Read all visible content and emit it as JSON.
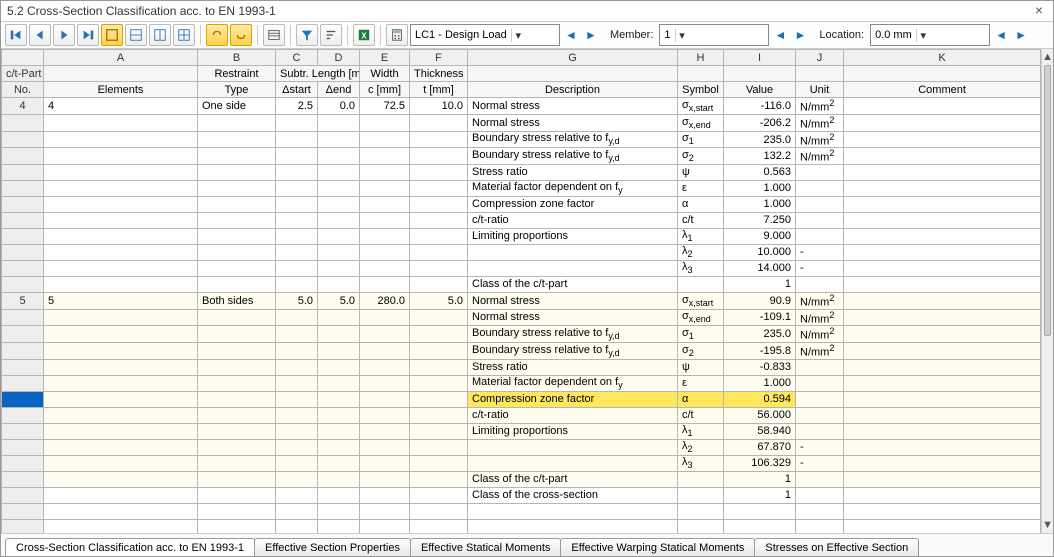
{
  "window": {
    "title": "5.2 Cross-Section Classification acc. to EN 1993-1"
  },
  "toolbar": {
    "combo_loadcase": "LC1 - Design Load",
    "label_member": "Member:",
    "combo_member": "1",
    "label_location": "Location:",
    "combo_location": "0.0 mm"
  },
  "columns": {
    "letters": [
      "A",
      "B",
      "C",
      "D",
      "E",
      "F",
      "G",
      "H",
      "I",
      "J",
      "K"
    ],
    "rowhead": [
      "c/t-Part",
      "No."
    ],
    "A": "Elements",
    "B": [
      "Restraint",
      "Type"
    ],
    "CD": "Subtr. Length [mm]",
    "C": "Δstart",
    "D": "Δend",
    "E": [
      "Width",
      "c [mm]"
    ],
    "F": [
      "Thickness",
      "t [mm]"
    ],
    "G": "Description",
    "H": "Symbol",
    "I": "Value",
    "J": "Unit",
    "K": "Comment"
  },
  "rows": [
    {
      "no": "4",
      "A": "4",
      "B": "One side",
      "C": "2.5",
      "D": "0.0",
      "E": "72.5",
      "F": "10.0",
      "G": "Normal stress",
      "H": "σ<sub>x,start</sub>",
      "I": "-116.0",
      "J": "N/mm<sup>2</sup>",
      "K": ""
    },
    {
      "G": "Normal stress",
      "H": "σ<sub>x,end</sub>",
      "I": "-206.2",
      "J": "N/mm<sup>2</sup>"
    },
    {
      "G": "Boundary stress relative to f<sub>y,d</sub>",
      "H": "σ<sub>1</sub>",
      "I": "235.0",
      "J": "N/mm<sup>2</sup>"
    },
    {
      "G": "Boundary stress relative to f<sub>y,d</sub>",
      "H": "σ<sub>2</sub>",
      "I": "132.2",
      "J": "N/mm<sup>2</sup>"
    },
    {
      "G": "Stress ratio",
      "H": "ψ",
      "I": "0.563",
      "J": ""
    },
    {
      "G": "Material factor dependent on f<sub>y</sub>",
      "H": "ε",
      "I": "1.000",
      "J": ""
    },
    {
      "G": "Compression zone factor",
      "H": "α",
      "I": "1.000",
      "J": ""
    },
    {
      "G": "c/t-ratio",
      "H": "c/t",
      "I": "7.250",
      "J": ""
    },
    {
      "G": "Limiting proportions",
      "H": "λ<sub>1</sub>",
      "I": "9.000",
      "J": ""
    },
    {
      "G": "",
      "H": "λ<sub>2</sub>",
      "I": "10.000",
      "J": "-"
    },
    {
      "G": "",
      "H": "λ<sub>3</sub>",
      "I": "14.000",
      "J": "-"
    },
    {
      "G": "Class of the c/t-part",
      "H": "",
      "I": "1",
      "J": ""
    },
    {
      "alt": true,
      "no": "5",
      "A": "5",
      "B": "Both sides",
      "C": "5.0",
      "D": "5.0",
      "E": "280.0",
      "F": "5.0",
      "G": "Normal stress",
      "H": "σ<sub>x,start</sub>",
      "I": "90.9",
      "J": "N/mm<sup>2</sup>"
    },
    {
      "alt": true,
      "G": "Normal stress",
      "H": "σ<sub>x,end</sub>",
      "I": "-109.1",
      "J": "N/mm<sup>2</sup>"
    },
    {
      "alt": true,
      "G": "Boundary stress relative to f<sub>y,d</sub>",
      "H": "σ<sub>1</sub>",
      "I": "235.0",
      "J": "N/mm<sup>2</sup>"
    },
    {
      "alt": true,
      "G": "Boundary stress relative to f<sub>y,d</sub>",
      "H": "σ<sub>2</sub>",
      "I": "-195.8",
      "J": "N/mm<sup>2</sup>"
    },
    {
      "alt": true,
      "G": "Stress ratio",
      "H": "ψ",
      "I": "-0.833",
      "J": ""
    },
    {
      "alt": true,
      "G": "Material factor dependent on f<sub>y</sub>",
      "H": "ε",
      "I": "1.000",
      "J": ""
    },
    {
      "alt": true,
      "selected": true,
      "G": "Compression zone factor",
      "H": "α",
      "I": "0.594",
      "J": ""
    },
    {
      "alt": true,
      "G": "c/t-ratio",
      "H": "c/t",
      "I": "56.000",
      "J": ""
    },
    {
      "alt": true,
      "G": "Limiting proportions",
      "H": "λ<sub>1</sub>",
      "I": "58.940",
      "J": ""
    },
    {
      "alt": true,
      "G": "",
      "H": "λ<sub>2</sub>",
      "I": "67.870",
      "J": "-"
    },
    {
      "alt": true,
      "G": "",
      "H": "λ<sub>3</sub>",
      "I": "106.329",
      "J": "-"
    },
    {
      "alt": true,
      "G": "Class of the c/t-part",
      "H": "",
      "I": "1",
      "J": ""
    },
    {
      "G": "Class of the cross-section",
      "H": "",
      "I": "1",
      "J": ""
    }
  ],
  "tabs": [
    "Cross-Section Classification acc. to EN 1993-1",
    "Effective Section Properties",
    "Effective Statical Moments",
    "Effective Warping Statical Moments",
    "Stresses on Effective Section"
  ],
  "active_tab": 0,
  "selected_col_letter": "I"
}
